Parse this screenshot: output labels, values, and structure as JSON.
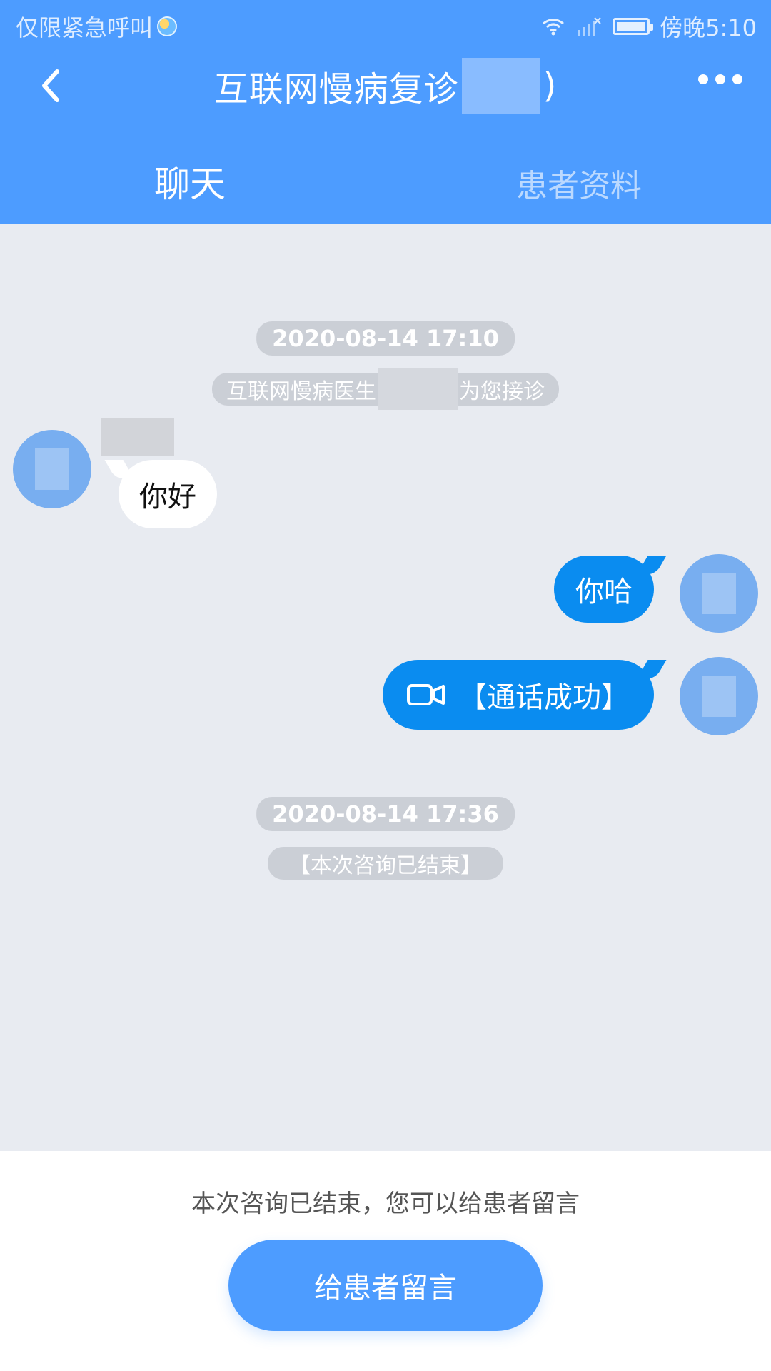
{
  "status_bar": {
    "left_text": "仅限紧急呼叫",
    "time": "傍晚5:10"
  },
  "header": {
    "title_prefix": "互联网慢病复诊",
    "title_suffix": ")"
  },
  "tabs": [
    {
      "label": "聊天"
    },
    {
      "label": "患者资料"
    }
  ],
  "messages": {
    "time_1": "2020-08-14 17:10",
    "system_1_part_1": "互联网慢病医生",
    "system_1_part_2": "为您接诊",
    "left_1": "你好",
    "right_1": "你哈",
    "right_call": "【通话成功】",
    "time_2": "2020-08-14 17:36",
    "system_2": "【本次咨询已结束】"
  },
  "footer": {
    "note": "本次咨询已结束，您可以给患者留言",
    "button": "给患者留言"
  },
  "colors": {
    "header": "#4d9cff",
    "chat_bg": "#e8ebf1",
    "outgoing_bubble": "#0a8cf0",
    "incoming_bubble": "#ffffff",
    "footer_bg": "#ffffff"
  },
  "icons": {
    "back": "back-icon",
    "more": "more-icon",
    "video": "video-call-icon",
    "wifi": "wifi-icon",
    "signal": "signal-icon",
    "battery": "battery-icon"
  }
}
